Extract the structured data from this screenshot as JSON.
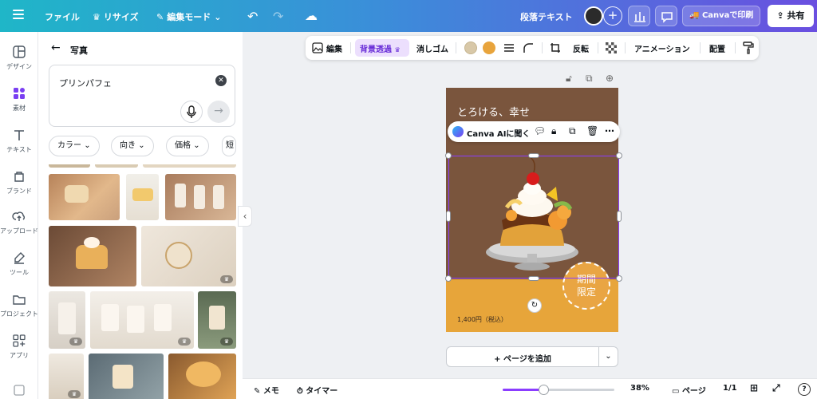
{
  "topbar": {
    "file": "ファイル",
    "resize": "リサイズ",
    "edit_mode": "編集モード",
    "doc_title": "段落テキスト",
    "print": "Canvaで印刷",
    "share": "共有"
  },
  "rail": [
    {
      "label": "デザイン",
      "icon": "layout-icon"
    },
    {
      "label": "素材",
      "icon": "elements-icon"
    },
    {
      "label": "テキスト",
      "icon": "text-icon"
    },
    {
      "label": "ブランド",
      "icon": "brand-icon"
    },
    {
      "label": "アップロード",
      "icon": "upload-icon"
    },
    {
      "label": "ツール",
      "icon": "draw-icon"
    },
    {
      "label": "プロジェクト",
      "icon": "folder-icon"
    },
    {
      "label": "アプリ",
      "icon": "apps-icon"
    }
  ],
  "panel": {
    "title": "写真",
    "search_value": "プリンパフェ",
    "filters": [
      "カラー",
      "向き",
      "価格",
      "短"
    ]
  },
  "toolbar": {
    "edit": "編集",
    "bg_remove": "背景透過",
    "eraser": "消しゴム",
    "flip": "反転",
    "animation": "アニメーション",
    "position": "配置",
    "swatch1": "#d8c8a8",
    "swatch2": "#e8a43c"
  },
  "canvas": {
    "tagline": "とろける、幸せ",
    "ai_label": "Canva AIに聞く",
    "badge_line1": "期間",
    "badge_line2": "限定",
    "price": "1,400円（税込）",
    "add_page": "+ ページを追加"
  },
  "bottombar": {
    "memo": "メモ",
    "timer": "タイマー",
    "zoom": "38%",
    "pages": "ページ",
    "page_count": "1/1"
  }
}
